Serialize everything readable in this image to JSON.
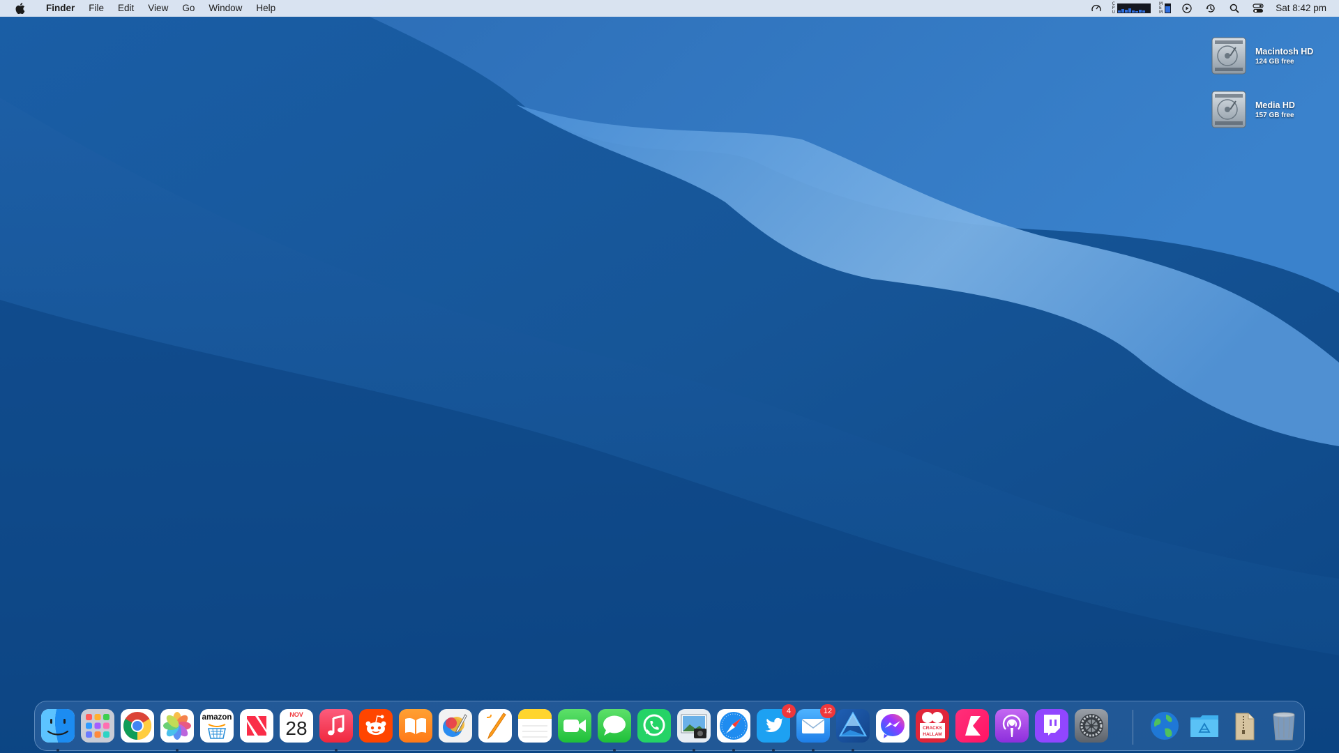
{
  "menubar": {
    "app_name": "Finder",
    "menus": [
      "File",
      "Edit",
      "View",
      "Go",
      "Window",
      "Help"
    ],
    "status_icons": [
      "speedometer-icon",
      "cpu-meter-icon",
      "memory-meter-icon",
      "play-icon",
      "time-machine-icon",
      "search-icon",
      "control-center-icon"
    ],
    "clock": "Sat 8:42 pm"
  },
  "desktop": {
    "drives": [
      {
        "name": "Macintosh HD",
        "free": "124 GB free"
      },
      {
        "name": "Media HD",
        "free": "157 GB free"
      }
    ]
  },
  "dock": {
    "items": [
      {
        "app": "Finder",
        "icon": "finder-icon",
        "running": true
      },
      {
        "app": "Launchpad",
        "icon": "launchpad-icon",
        "running": false
      },
      {
        "app": "Google Chrome",
        "icon": "chrome-icon",
        "running": false
      },
      {
        "app": "Photos",
        "icon": "photos-icon",
        "running": true
      },
      {
        "app": "Amazon",
        "icon": "amazon-icon",
        "running": false,
        "label": "amazon"
      },
      {
        "app": "News",
        "icon": "news-icon",
        "running": false
      },
      {
        "app": "Calendar",
        "icon": "calendar-icon",
        "running": false,
        "month": "NOV",
        "day": "28"
      },
      {
        "app": "Music",
        "icon": "music-icon",
        "running": true
      },
      {
        "app": "Reddit",
        "icon": "reddit-icon",
        "running": false
      },
      {
        "app": "Books",
        "icon": "books-icon",
        "running": false
      },
      {
        "app": "Pixelmator",
        "icon": "pixelmator-icon",
        "running": false
      },
      {
        "app": "Pages",
        "icon": "pages-icon",
        "running": false
      },
      {
        "app": "Notes",
        "icon": "notes-icon",
        "running": false
      },
      {
        "app": "FaceTime",
        "icon": "facetime-icon",
        "running": false
      },
      {
        "app": "Messages",
        "icon": "messages-icon",
        "running": true
      },
      {
        "app": "WhatsApp",
        "icon": "whatsapp-icon",
        "running": false
      },
      {
        "app": "Preview",
        "icon": "preview-icon",
        "running": true
      },
      {
        "app": "Safari",
        "icon": "safari-icon",
        "running": true
      },
      {
        "app": "Twitter",
        "icon": "twitter-icon",
        "running": true,
        "badge": "4"
      },
      {
        "app": "Mail",
        "icon": "mail-icon",
        "running": true,
        "badge": "12"
      },
      {
        "app": "Affinity Designer",
        "icon": "affinity-icon",
        "running": true
      },
      {
        "app": "Messenger",
        "icon": "messenger-icon",
        "running": false
      },
      {
        "app": "Cracks Hallam",
        "icon": "cracks-hallam-icon",
        "running": false
      },
      {
        "app": "Klokki",
        "icon": "klokki-icon",
        "running": false
      },
      {
        "app": "Podcasts",
        "icon": "podcasts-icon",
        "running": false
      },
      {
        "app": "Twitch",
        "icon": "twitch-icon",
        "running": false
      },
      {
        "app": "System Preferences",
        "icon": "gear-icon",
        "running": false
      },
      {
        "app": "Network Globe",
        "icon": "globe-icon",
        "running": false
      },
      {
        "app": "Applications",
        "icon": "applications-folder-icon",
        "running": false
      },
      {
        "app": "Archive",
        "icon": "archive-icon",
        "running": false
      },
      {
        "app": "Trash",
        "icon": "trash-icon",
        "running": false
      }
    ]
  },
  "colors": {
    "wallpaper_dark": "#0d4a8a",
    "wallpaper_light": "#6aa6e2",
    "badge": "#f0373b"
  }
}
